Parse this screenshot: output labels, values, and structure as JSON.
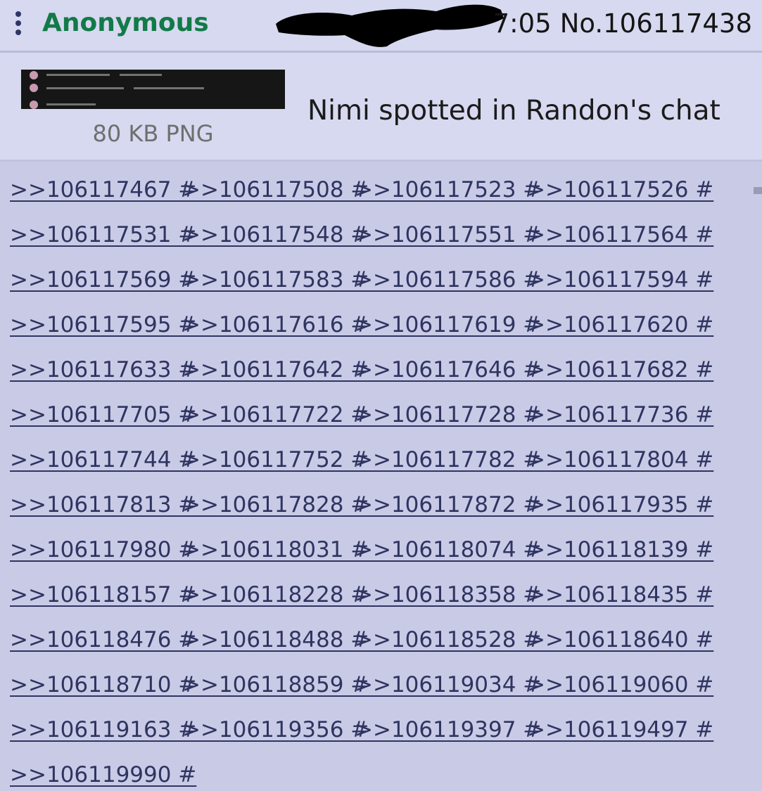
{
  "post": {
    "name": "Anonymous",
    "time_tail": "7:05",
    "post_number": "No.106117438",
    "icons": {
      "menu": "vertical-dots-icon"
    }
  },
  "op": {
    "file_info": "80 KB PNG",
    "comment": "Nimi spotted in Randon's chat"
  },
  "replies": [
    ">>106117467 #",
    ">>106117508 #",
    ">>106117523 #",
    ">>106117526 #",
    ">>106117531 #",
    ">>106117548 #",
    ">>106117551 #",
    ">>106117564 #",
    ">>106117569 #",
    ">>106117583 #",
    ">>106117586 #",
    ">>106117594 #",
    ">>106117595 #",
    ">>106117616 #",
    ">>106117619 #",
    ">>106117620 #",
    ">>106117633 #",
    ">>106117642 #",
    ">>106117646 #",
    ">>106117682 #",
    ">>106117705 #",
    ">>106117722 #",
    ">>106117728 #",
    ">>106117736 #",
    ">>106117744 #",
    ">>106117752 #",
    ">>106117782 #",
    ">>106117804 #",
    ">>106117813 #",
    ">>106117828 #",
    ">>106117872 #",
    ">>106117935 #",
    ">>106117980 #",
    ">>106118031 #",
    ">>106118074 #",
    ">>106118139 #",
    ">>106118157 #",
    ">>106118228 #",
    ">>106118358 #",
    ">>106118435 #",
    ">>106118476 #",
    ">>106118488 #",
    ">>106118528 #",
    ">>106118640 #",
    ">>106118710 #",
    ">>106118859 #",
    ">>106119034 #",
    ">>106119060 #",
    ">>106119163 #",
    ">>106119356 #",
    ">>106119397 #",
    ">>106119497 #",
    ">>106119990 #"
  ],
  "colors": {
    "background": "#c9cbe6",
    "header": "#d6d9ef",
    "name": "#127a48",
    "link": "#2f3461"
  }
}
